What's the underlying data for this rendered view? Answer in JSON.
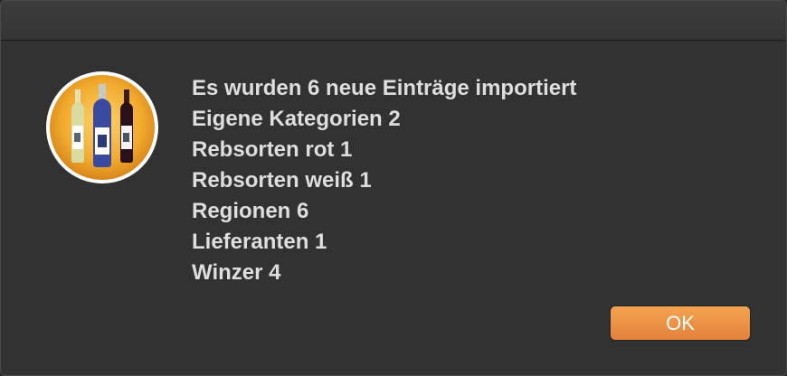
{
  "dialog": {
    "lines": [
      "Es wurden 6 neue Einträge importiert",
      "Eigene Kategorien 2",
      "Rebsorten rot 1",
      "Rebsorten weiß 1",
      "Regionen 6",
      "Lieferanten 1",
      "Winzer 4"
    ],
    "ok_label": "OK",
    "icon": "wine-bottles-icon"
  },
  "colors": {
    "background": "#323232",
    "text": "#dedede",
    "accent": "#ee9a4a",
    "icon_circle": "#f0a92c"
  }
}
